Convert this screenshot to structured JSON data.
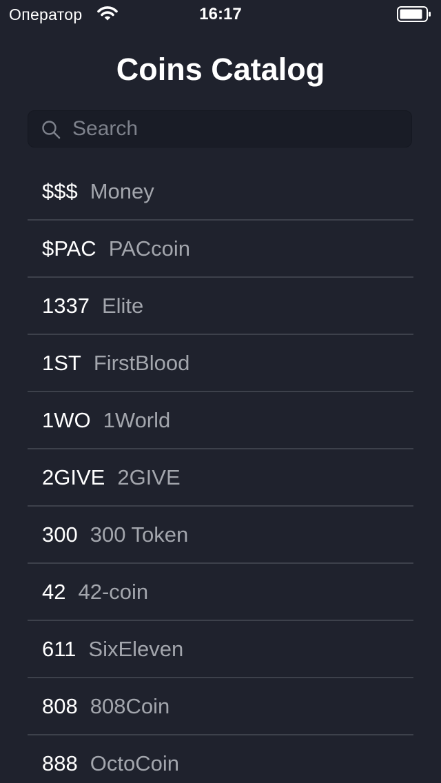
{
  "status_bar": {
    "carrier": "Оператор",
    "time": "16:17",
    "wifi_icon": "wifi-icon",
    "battery_icon": "battery-icon"
  },
  "header": {
    "title": "Coins Catalog"
  },
  "search": {
    "placeholder": "Search",
    "value": "",
    "icon": "search-icon"
  },
  "coins": [
    {
      "symbol": "$$$",
      "name": "Money"
    },
    {
      "symbol": "$PAC",
      "name": "PACcoin"
    },
    {
      "symbol": "1337",
      "name": "Elite"
    },
    {
      "symbol": "1ST",
      "name": "FirstBlood"
    },
    {
      "symbol": "1WO",
      "name": "1World"
    },
    {
      "symbol": "2GIVE",
      "name": "2GIVE"
    },
    {
      "symbol": "300",
      "name": "300 Token"
    },
    {
      "symbol": "42",
      "name": "42-coin"
    },
    {
      "symbol": "611",
      "name": "SixEleven"
    },
    {
      "symbol": "808",
      "name": "808Coin"
    },
    {
      "symbol": "888",
      "name": "OctoCoin"
    }
  ],
  "colors": {
    "background": "#1f222d",
    "search_background": "#191c26",
    "separator": "#3d414b",
    "symbol_text": "#ffffff",
    "name_text": "#a3a6ad",
    "placeholder_text": "#7e828c"
  }
}
